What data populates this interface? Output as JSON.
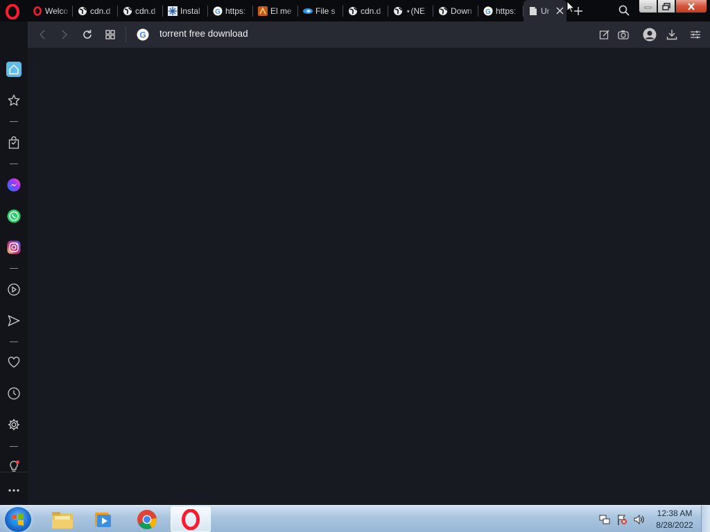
{
  "browser": {
    "name": "Opera",
    "colors": {
      "accent": "#5dbde8",
      "opera_red": "#ff1b2d",
      "background": "#171a20",
      "toolbar": "#272a33"
    }
  },
  "tabs": [
    {
      "title": "Welco",
      "icon": "opera-icon"
    },
    {
      "title": "cdn.d",
      "icon": "globe-icon"
    },
    {
      "title": "cdn.d",
      "icon": "globe-icon"
    },
    {
      "title": "Instal",
      "icon": "snowflake-icon"
    },
    {
      "title": "https:",
      "icon": "google-icon"
    },
    {
      "title": "El me",
      "icon": "site-icon"
    },
    {
      "title": "File s",
      "icon": "blue-site-icon"
    },
    {
      "title": "cdn.d",
      "icon": "globe-icon"
    },
    {
      "title": "⋆(NE",
      "icon": "globe-icon"
    },
    {
      "title": "Down",
      "icon": "globe-icon"
    },
    {
      "title": "https:",
      "icon": "google-icon"
    },
    {
      "title": "Ur",
      "icon": "document-icon",
      "active": true
    }
  ],
  "address_bar": {
    "value": "torrent free download",
    "search_engine": "google-icon"
  },
  "sidebar": {
    "items": [
      "home-icon",
      "bookmark-star-icon",
      "shopping-bag-icon",
      "messenger-icon",
      "whatsapp-icon",
      "instagram-icon",
      "player-icon",
      "send-icon",
      "heart-icon",
      "history-clock-icon",
      "settings-gear-icon",
      "lightbulb-icon",
      "more-icon"
    ]
  },
  "taskbar": {
    "apps": [
      "start-orb-icon",
      "file-explorer-icon",
      "media-player-icon",
      "chrome-icon",
      "opera-icon"
    ],
    "clock": {
      "time": "12:38 AM",
      "date": "8/28/2022"
    }
  }
}
